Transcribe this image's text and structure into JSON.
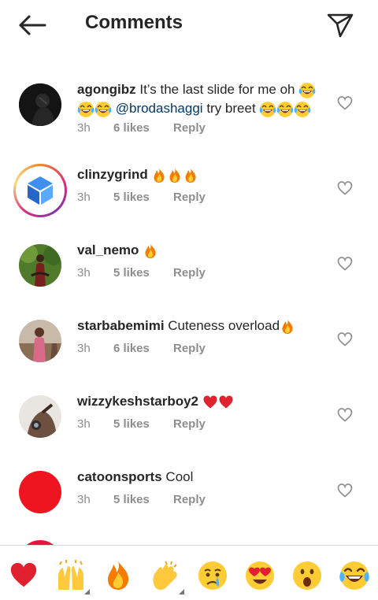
{
  "header": {
    "title": "Comments"
  },
  "icons": {
    "back": "arrow-left-icon",
    "send": "paper-plane-icon",
    "like": "heart-outline-icon"
  },
  "colors": {
    "username": "#262626",
    "meta": "#8e8e8e",
    "mention": "#00376b",
    "heart": "#e0212f",
    "fire": "#f57c00",
    "partial_avatar": "#e8143b"
  },
  "comments": [
    {
      "username": "agongibz",
      "text_a": "It’s the last slide for me oh",
      "mention": "@brodashaggi",
      "text_b": "try breet",
      "time": "3h",
      "likes": "6 likes",
      "reply": "Reply"
    },
    {
      "username": "clinzygrind",
      "time": "3h",
      "likes": "5 likes",
      "reply": "Reply"
    },
    {
      "username": "val_nemo",
      "time": "3h",
      "likes": "5 likes",
      "reply": "Reply"
    },
    {
      "username": "starbabemimi",
      "text": "Cuteness overload",
      "time": "3h",
      "likes": "6 likes",
      "reply": "Reply"
    },
    {
      "username": "wizzykeshstarboy2",
      "time": "3h",
      "likes": "5 likes",
      "reply": "Reply"
    },
    {
      "username": "catoonsports",
      "text": "Cool",
      "time": "3h",
      "likes": "5 likes",
      "reply": "Reply"
    }
  ],
  "reactions": [
    "red-heart",
    "raising-hands",
    "fire",
    "clapping-hands",
    "sad-but-relieved-face",
    "heart-eyes-face",
    "surprised-face",
    "tears-of-joy-face"
  ]
}
